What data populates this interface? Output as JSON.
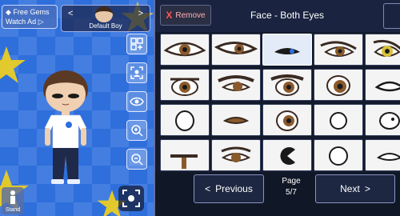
{
  "toolbar_left": {
    "gems_line1": "Free Gems",
    "gems_line2": "Watch Ad",
    "character_name": "Default Boy",
    "stand_label": "Stand"
  },
  "panel": {
    "remove_label": "Remove",
    "title": "Face - Both Eyes",
    "prev_label": "Previous",
    "next_label": "Next",
    "page_label": "Page",
    "page_value": "5/7"
  },
  "icons": [
    "diamond-icon",
    "play-icon",
    "chevron-left-icon",
    "chevron-right-icon",
    "grid-icon",
    "scan-icon",
    "eye-icon",
    "zoom-in-icon",
    "zoom-out-icon",
    "camera-icon",
    "close-icon"
  ],
  "colors": {
    "stage_blue": "#2f6fdc",
    "panel_bg": "#121a2c",
    "star_yellow": "#f4d21a",
    "remove_red": "#ff5555"
  },
  "eye_options": [
    {
      "style": "brown-almond"
    },
    {
      "style": "brown-sharp"
    },
    {
      "style": "dark-closed",
      "selected": true
    },
    {
      "style": "brown-lashed"
    },
    {
      "style": "yellow-lashed"
    },
    {
      "style": "brown-round"
    },
    {
      "style": "brown-wide"
    },
    {
      "style": "brown-heavy"
    },
    {
      "style": "brown-big"
    },
    {
      "style": "white-oval"
    },
    {
      "style": "white-blank"
    },
    {
      "style": "brown-squint"
    },
    {
      "style": "brown-open"
    },
    {
      "style": "white-round"
    },
    {
      "style": "white-dot"
    },
    {
      "style": "brown-tired"
    },
    {
      "style": "brown-lash-low"
    },
    {
      "style": "black-pacman"
    },
    {
      "style": "white-circle"
    },
    {
      "style": "white-sleepy"
    }
  ]
}
